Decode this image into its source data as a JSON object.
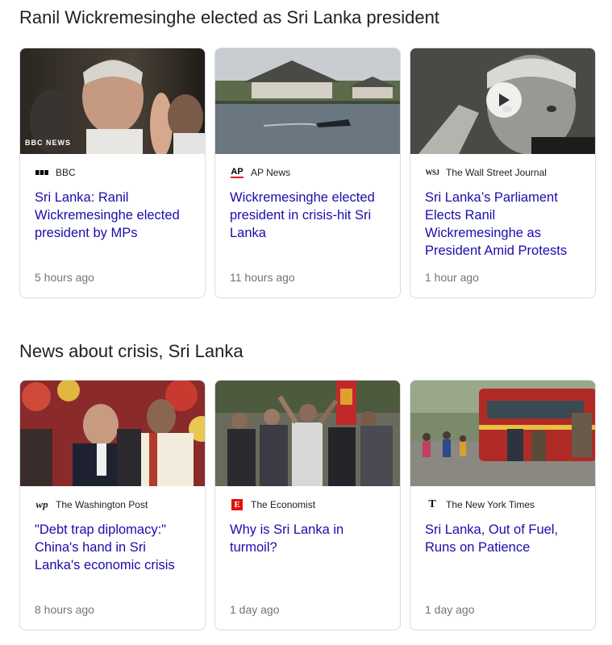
{
  "sections": [
    {
      "title": "Ranil Wickremesinghe elected as Sri Lanka president",
      "cards": [
        {
          "source": "BBC",
          "logo_icon": "bbc-logo-icon",
          "headline": "Sri Lanka: Ranil Wickremesinghe elected president by MPs",
          "time": "5 hours ago",
          "image_badge": "BBC NEWS"
        },
        {
          "source": "AP News",
          "logo_icon": "ap-logo-icon",
          "logo_text": "AP",
          "headline": "Wickremesinghe elected president in crisis-hit Sri Lanka",
          "time": "11 hours ago"
        },
        {
          "source": "The Wall Street Journal",
          "logo_icon": "wsj-logo-icon",
          "logo_text": "WSJ",
          "headline": "Sri Lanka’s Parliament Elects Ranil Wickremesinghe as President Amid Protests",
          "time": "1 hour ago",
          "has_video": true
        }
      ]
    },
    {
      "title": "News about crisis, Sri Lanka",
      "cards": [
        {
          "source": "The Washington Post",
          "logo_icon": "wapo-logo-icon",
          "logo_text": "wp",
          "headline": "\"Debt trap diplomacy:\" China's hand in Sri Lanka's economic crisis",
          "time": "8 hours ago"
        },
        {
          "source": "The Economist",
          "logo_icon": "economist-logo-icon",
          "logo_text": "E",
          "headline": "Why is Sri Lanka in turmoil?",
          "time": "1 day ago"
        },
        {
          "source": "The New York Times",
          "logo_icon": "nyt-logo-icon",
          "logo_text": "T",
          "headline": "Sri Lanka, Out of Fuel, Runs on Patience",
          "time": "1 day ago"
        }
      ]
    }
  ],
  "colors": {
    "link": "#1a0dab",
    "meta": "#70757a",
    "border": "#dadce0"
  }
}
